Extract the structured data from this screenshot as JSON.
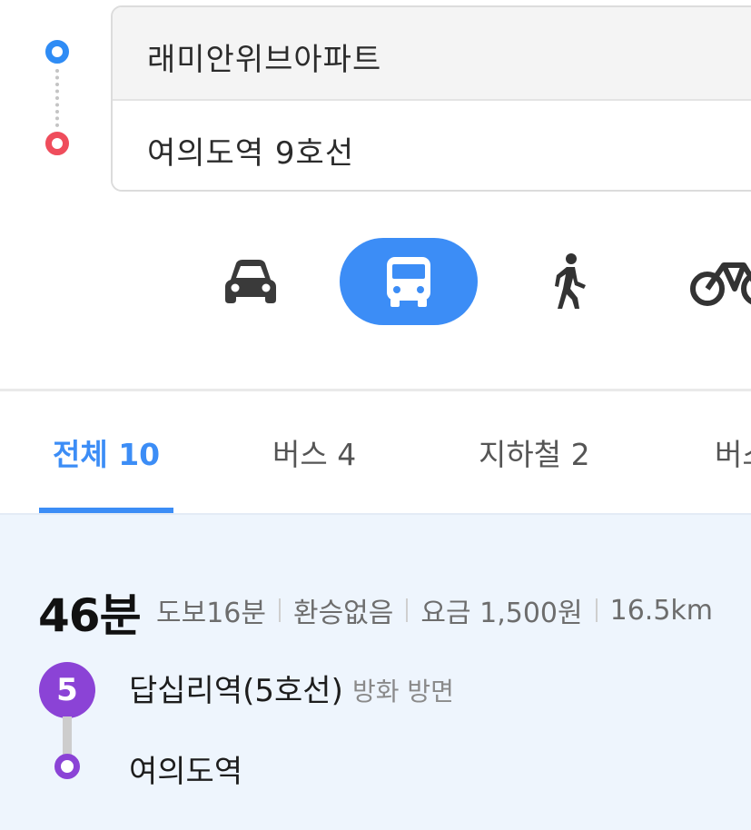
{
  "route": {
    "origin": "래미안위브아파트",
    "destination": "여의도역 9호선"
  },
  "modes": [
    {
      "icon": "car-icon",
      "selected": false
    },
    {
      "icon": "bus-icon",
      "selected": true
    },
    {
      "icon": "walk-icon",
      "selected": false
    },
    {
      "icon": "bike-icon",
      "selected": false
    }
  ],
  "tabs": [
    "전체 10",
    "버스 4",
    "지하철 2",
    "버스"
  ],
  "result": {
    "duration": "46분",
    "walk": "도보16분",
    "transfer": "환승없음",
    "fare": "요금 1,500원",
    "distance": "16.5km",
    "line_number": "5",
    "board_station": "답십리역(5호선)",
    "direction": "방화 방면",
    "alight_station": "여의도역"
  },
  "colors": {
    "accent": "#3c8df6",
    "origin_dot": "#2f8cf5",
    "destination_dot": "#ef4d5c",
    "line5": "#8b43d6",
    "panel_bg": "#eef5fd"
  }
}
